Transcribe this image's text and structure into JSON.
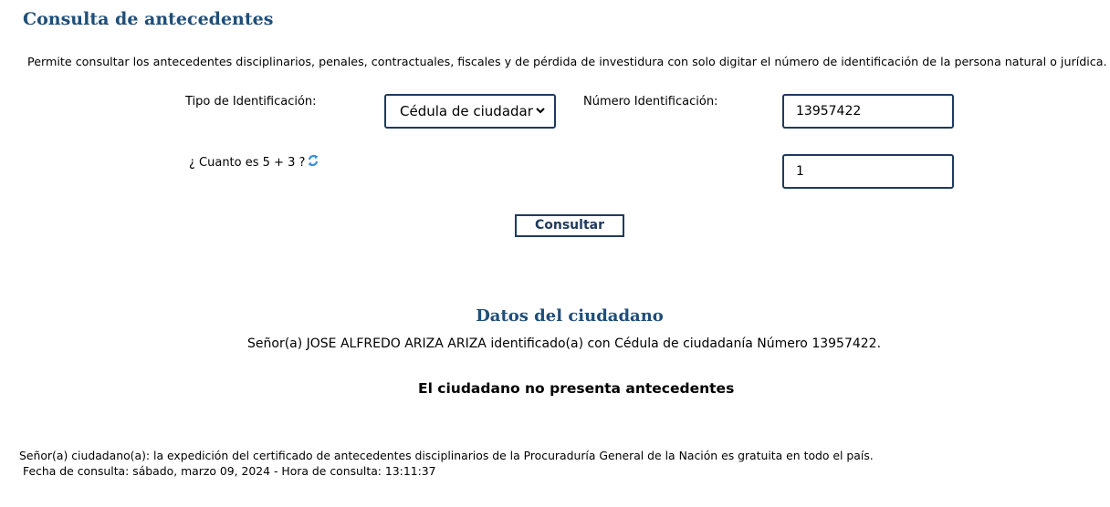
{
  "page": {
    "title": "Consulta de antecedentes",
    "intro": "Permite consultar los antecedentes disciplinarios, penales, contractuales, fiscales y de pérdida de investidura con solo digitar el número de identificación de la persona natural o jurídica."
  },
  "form": {
    "id_type_label": "Tipo de Identificación:",
    "id_type_value": "Cédula de ciudadar",
    "id_number_label": "Número Identificación:",
    "id_number_value": "13957422",
    "captcha_question": "¿ Cuanto es 5 + 3 ?",
    "captcha_answer": "1",
    "refresh_icon": "refresh-icon",
    "submit_label": "Consultar"
  },
  "result": {
    "section_title": "Datos del ciudadano",
    "citizen_line": "Señor(a)  JOSE ALFREDO ARIZA ARIZA identificado(a) con Cédula de ciudadanía Número 13957422.",
    "status": "El ciudadano no presenta antecedentes"
  },
  "footer": {
    "notice": "Señor(a) ciudadano(a): la expedición del certificado de antecedentes disciplinarios de la Procuraduría General de la Nación es gratuita en todo el país.",
    "timestamp": "Fecha de consulta: sábado, marzo 09, 2024 - Hora de consulta: 13:11:37"
  },
  "colors": {
    "title_blue": "#1f4e79",
    "border_navy": "#1f3a5f",
    "refresh_blue": "#3a8fd6"
  }
}
